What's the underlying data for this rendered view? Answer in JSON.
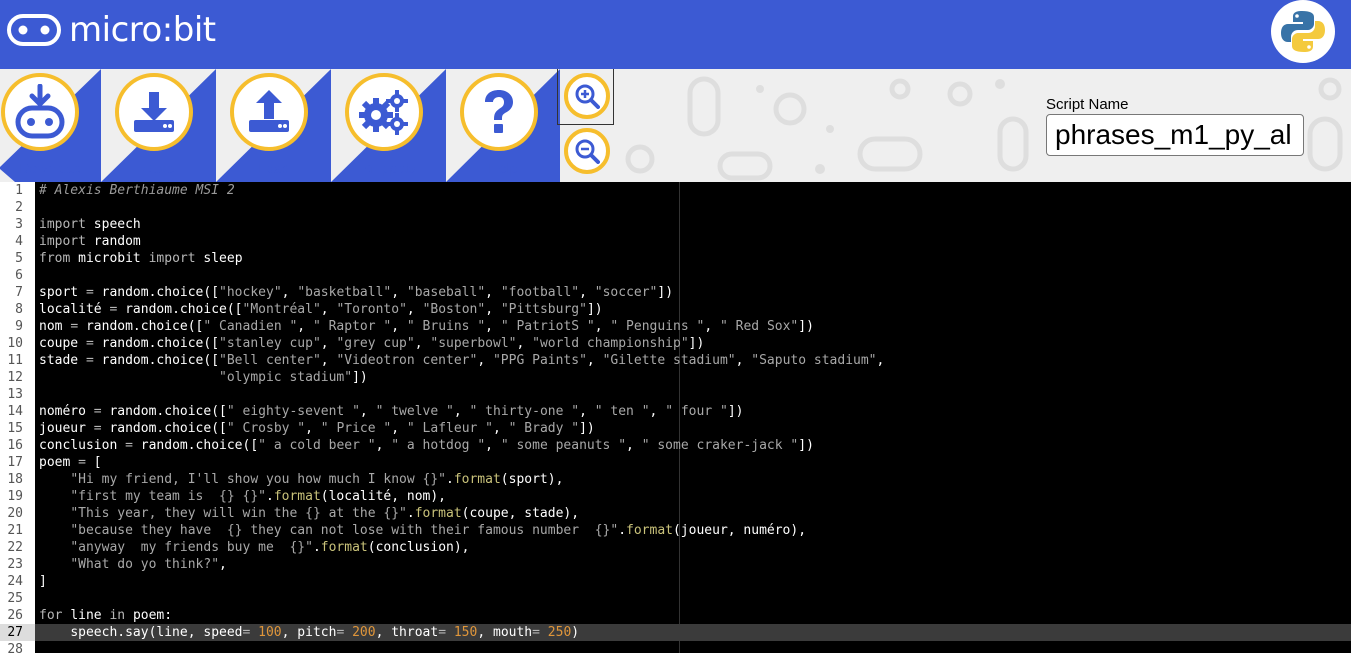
{
  "header": {
    "brand": "micro:bit",
    "python_logo": "python-logo-icon",
    "brand_color": "#3c5ad3",
    "accent_color": "#f6be2d"
  },
  "toolbar": {
    "download_label": "Download",
    "save_label": "Save",
    "load_label": "Load",
    "snippets_label": "Snippets",
    "help_label": "Help",
    "zoom_in_icon": "zoom-in-icon",
    "zoom_out_icon": "zoom-out-icon"
  },
  "script": {
    "label": "Script Name",
    "value": "phrases_m1_py_al"
  },
  "editor": {
    "active_line": 27,
    "line_numbers": [
      "1",
      "2",
      "3",
      "4",
      "5",
      "6",
      "7",
      "8",
      "9",
      "10",
      "11",
      "12",
      "13",
      "14",
      "15",
      "16",
      "17",
      "18",
      "19",
      "20",
      "21",
      "22",
      "23",
      "24",
      "25",
      "26",
      "27",
      "28"
    ],
    "lines": [
      [
        [
          "c",
          "# Alexis Berthiaume MSI 2"
        ]
      ],
      [],
      [
        [
          "k",
          "import"
        ],
        [
          "p",
          " "
        ],
        [
          "i",
          "speech"
        ]
      ],
      [
        [
          "k",
          "import"
        ],
        [
          "p",
          " "
        ],
        [
          "i",
          "random"
        ]
      ],
      [
        [
          "k",
          "from"
        ],
        [
          "p",
          " "
        ],
        [
          "i",
          "microbit"
        ],
        [
          "p",
          " "
        ],
        [
          "k",
          "import"
        ],
        [
          "p",
          " "
        ],
        [
          "i",
          "sleep"
        ]
      ],
      [],
      [
        [
          "i",
          "sport"
        ],
        [
          "p",
          " "
        ],
        [
          "o",
          "="
        ],
        [
          "p",
          " "
        ],
        [
          "i",
          "random.choice(["
        ],
        [
          "s",
          "\"hockey\""
        ],
        [
          "p",
          ", "
        ],
        [
          "s",
          "\"basketball\""
        ],
        [
          "p",
          ", "
        ],
        [
          "s",
          "\"baseball\""
        ],
        [
          "p",
          ", "
        ],
        [
          "s",
          "\"football\""
        ],
        [
          "p",
          ", "
        ],
        [
          "s",
          "\"soccer\""
        ],
        [
          "p",
          "])"
        ]
      ],
      [
        [
          "i",
          "localité"
        ],
        [
          "p",
          " "
        ],
        [
          "o",
          "="
        ],
        [
          "p",
          " "
        ],
        [
          "i",
          "random.choice(["
        ],
        [
          "s",
          "\"Montréal\""
        ],
        [
          "p",
          ", "
        ],
        [
          "s",
          "\"Toronto\""
        ],
        [
          "p",
          ", "
        ],
        [
          "s",
          "\"Boston\""
        ],
        [
          "p",
          ", "
        ],
        [
          "s",
          "\"Pittsburg\""
        ],
        [
          "p",
          "])"
        ]
      ],
      [
        [
          "i",
          "nom"
        ],
        [
          "p",
          " "
        ],
        [
          "o",
          "="
        ],
        [
          "p",
          " "
        ],
        [
          "i",
          "random.choice(["
        ],
        [
          "s",
          "\" Canadien \""
        ],
        [
          "p",
          ", "
        ],
        [
          "s",
          "\" Raptor \""
        ],
        [
          "p",
          ", "
        ],
        [
          "s",
          "\" Bruins \""
        ],
        [
          "p",
          ", "
        ],
        [
          "s",
          "\" PatriotS \""
        ],
        [
          "p",
          ", "
        ],
        [
          "s",
          "\" Penguins \""
        ],
        [
          "p",
          ", "
        ],
        [
          "s",
          "\" Red Sox\""
        ],
        [
          "p",
          "])"
        ]
      ],
      [
        [
          "i",
          "coupe"
        ],
        [
          "p",
          " "
        ],
        [
          "o",
          "="
        ],
        [
          "p",
          " "
        ],
        [
          "i",
          "random.choice(["
        ],
        [
          "s",
          "\"stanley cup\""
        ],
        [
          "p",
          ", "
        ],
        [
          "s",
          "\"grey cup\""
        ],
        [
          "p",
          ", "
        ],
        [
          "s",
          "\"superbowl\""
        ],
        [
          "p",
          ", "
        ],
        [
          "s",
          "\"world championship\""
        ],
        [
          "p",
          "])"
        ]
      ],
      [
        [
          "i",
          "stade"
        ],
        [
          "p",
          " "
        ],
        [
          "o",
          "="
        ],
        [
          "p",
          " "
        ],
        [
          "i",
          "random.choice(["
        ],
        [
          "s",
          "\"Bell center\""
        ],
        [
          "p",
          ", "
        ],
        [
          "s",
          "\"Videotron center\""
        ],
        [
          "p",
          ", "
        ],
        [
          "s",
          "\"PPG Paints\""
        ],
        [
          "p",
          ", "
        ],
        [
          "s",
          "\"Gilette stadium\""
        ],
        [
          "p",
          ", "
        ],
        [
          "s",
          "\"Saputo stadium\""
        ],
        [
          "p",
          ","
        ]
      ],
      [
        [
          "p",
          "                       "
        ],
        [
          "s",
          "\"olympic stadium\""
        ],
        [
          "p",
          "])"
        ]
      ],
      [],
      [
        [
          "i",
          "noméro"
        ],
        [
          "p",
          " "
        ],
        [
          "o",
          "="
        ],
        [
          "p",
          " "
        ],
        [
          "i",
          "random.choice(["
        ],
        [
          "s",
          "\" eighty-sevent \""
        ],
        [
          "p",
          ", "
        ],
        [
          "s",
          "\" twelve \""
        ],
        [
          "p",
          ", "
        ],
        [
          "s",
          "\" thirty-one \""
        ],
        [
          "p",
          ", "
        ],
        [
          "s",
          "\" ten \""
        ],
        [
          "p",
          ", "
        ],
        [
          "s",
          "\" four \""
        ],
        [
          "p",
          "])"
        ]
      ],
      [
        [
          "i",
          "joueur"
        ],
        [
          "p",
          " "
        ],
        [
          "o",
          "="
        ],
        [
          "p",
          " "
        ],
        [
          "i",
          "random.choice(["
        ],
        [
          "s",
          "\" Crosby \""
        ],
        [
          "p",
          ", "
        ],
        [
          "s",
          "\" Price \""
        ],
        [
          "p",
          ", "
        ],
        [
          "s",
          "\" Lafleur \""
        ],
        [
          "p",
          ", "
        ],
        [
          "s",
          "\" Brady \""
        ],
        [
          "p",
          "])"
        ]
      ],
      [
        [
          "i",
          "conclusion"
        ],
        [
          "p",
          " "
        ],
        [
          "o",
          "="
        ],
        [
          "p",
          " "
        ],
        [
          "i",
          "random.choice(["
        ],
        [
          "s",
          "\" a cold beer \""
        ],
        [
          "p",
          ", "
        ],
        [
          "s",
          "\" a hotdog \""
        ],
        [
          "p",
          ", "
        ],
        [
          "s",
          "\" some peanuts \""
        ],
        [
          "p",
          ", "
        ],
        [
          "s",
          "\" some craker-jack \""
        ],
        [
          "p",
          "])"
        ]
      ],
      [
        [
          "i",
          "poem"
        ],
        [
          "p",
          " "
        ],
        [
          "o",
          "="
        ],
        [
          "p",
          " ["
        ]
      ],
      [
        [
          "p",
          "    "
        ],
        [
          "s",
          "\"Hi my friend, I'll show you how much I know {}\""
        ],
        [
          "p",
          "."
        ],
        [
          "f",
          "format"
        ],
        [
          "p",
          "(sport),"
        ]
      ],
      [
        [
          "p",
          "    "
        ],
        [
          "s",
          "\"first my team is  {} {}\""
        ],
        [
          "p",
          "."
        ],
        [
          "f",
          "format"
        ],
        [
          "p",
          "(localité, nom),"
        ]
      ],
      [
        [
          "p",
          "    "
        ],
        [
          "s",
          "\"This year, they will win the {} at the {}\""
        ],
        [
          "p",
          "."
        ],
        [
          "f",
          "format"
        ],
        [
          "p",
          "(coupe, stade),"
        ]
      ],
      [
        [
          "p",
          "    "
        ],
        [
          "s",
          "\"because they have  {} they can not lose with their famous number  {}\""
        ],
        [
          "p",
          "."
        ],
        [
          "f",
          "format"
        ],
        [
          "p",
          "(joueur, numéro),"
        ]
      ],
      [
        [
          "p",
          "    "
        ],
        [
          "s",
          "\"anyway  my friends buy me  {}\""
        ],
        [
          "p",
          "."
        ],
        [
          "f",
          "format"
        ],
        [
          "p",
          "(conclusion),"
        ]
      ],
      [
        [
          "p",
          "    "
        ],
        [
          "s",
          "\"What do yo think?\""
        ],
        [
          "p",
          ","
        ]
      ],
      [
        [
          "p",
          "]"
        ]
      ],
      [],
      [
        [
          "k",
          "for"
        ],
        [
          "p",
          " "
        ],
        [
          "i",
          "line"
        ],
        [
          "p",
          " "
        ],
        [
          "k",
          "in"
        ],
        [
          "p",
          " "
        ],
        [
          "i",
          "poem"
        ],
        [
          "p",
          ":"
        ]
      ],
      [
        [
          "p",
          "    "
        ],
        [
          "i",
          "speech.say(line, speed"
        ],
        [
          "o",
          "="
        ],
        [
          "p",
          " "
        ],
        [
          "n",
          "100"
        ],
        [
          "p",
          ", "
        ],
        [
          "i",
          "pitch"
        ],
        [
          "o",
          "="
        ],
        [
          "p",
          " "
        ],
        [
          "n",
          "200"
        ],
        [
          "p",
          ", "
        ],
        [
          "i",
          "throat"
        ],
        [
          "o",
          "="
        ],
        [
          "p",
          " "
        ],
        [
          "n",
          "150"
        ],
        [
          "p",
          ", "
        ],
        [
          "i",
          "mouth"
        ],
        [
          "o",
          "="
        ],
        [
          "p",
          " "
        ],
        [
          "n",
          "250"
        ],
        [
          "p",
          ")"
        ]
      ],
      []
    ]
  }
}
